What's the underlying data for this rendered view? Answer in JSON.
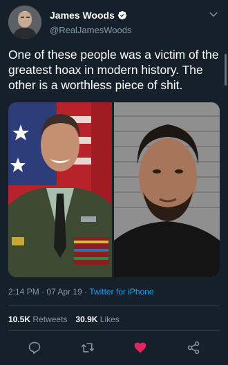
{
  "tweet": {
    "author_name": "James Woods",
    "author_handle": "@RealJamesWoods",
    "text": "One of these people was a victim of the greatest hoax in modern history. The other is a worthless piece of shit.",
    "time": "2:14 PM",
    "date": "07 Apr 19",
    "client": "Twitter for iPhone",
    "retweets_count": "10.5K",
    "retweets_label": "Retweets",
    "likes_count": "30.9K",
    "likes_label": "Likes",
    "liked": true
  },
  "colors": {
    "background": "#15202b",
    "secondary_text": "#8899a6",
    "accent": "#1da1f2",
    "like": "#e0245e",
    "divider": "#38444d"
  },
  "icons": {
    "verified": "verified-badge-icon",
    "menu": "chevron-down-icon",
    "reply": "reply-icon",
    "retweet": "retweet-icon",
    "like": "heart-icon",
    "share": "share-icon"
  }
}
